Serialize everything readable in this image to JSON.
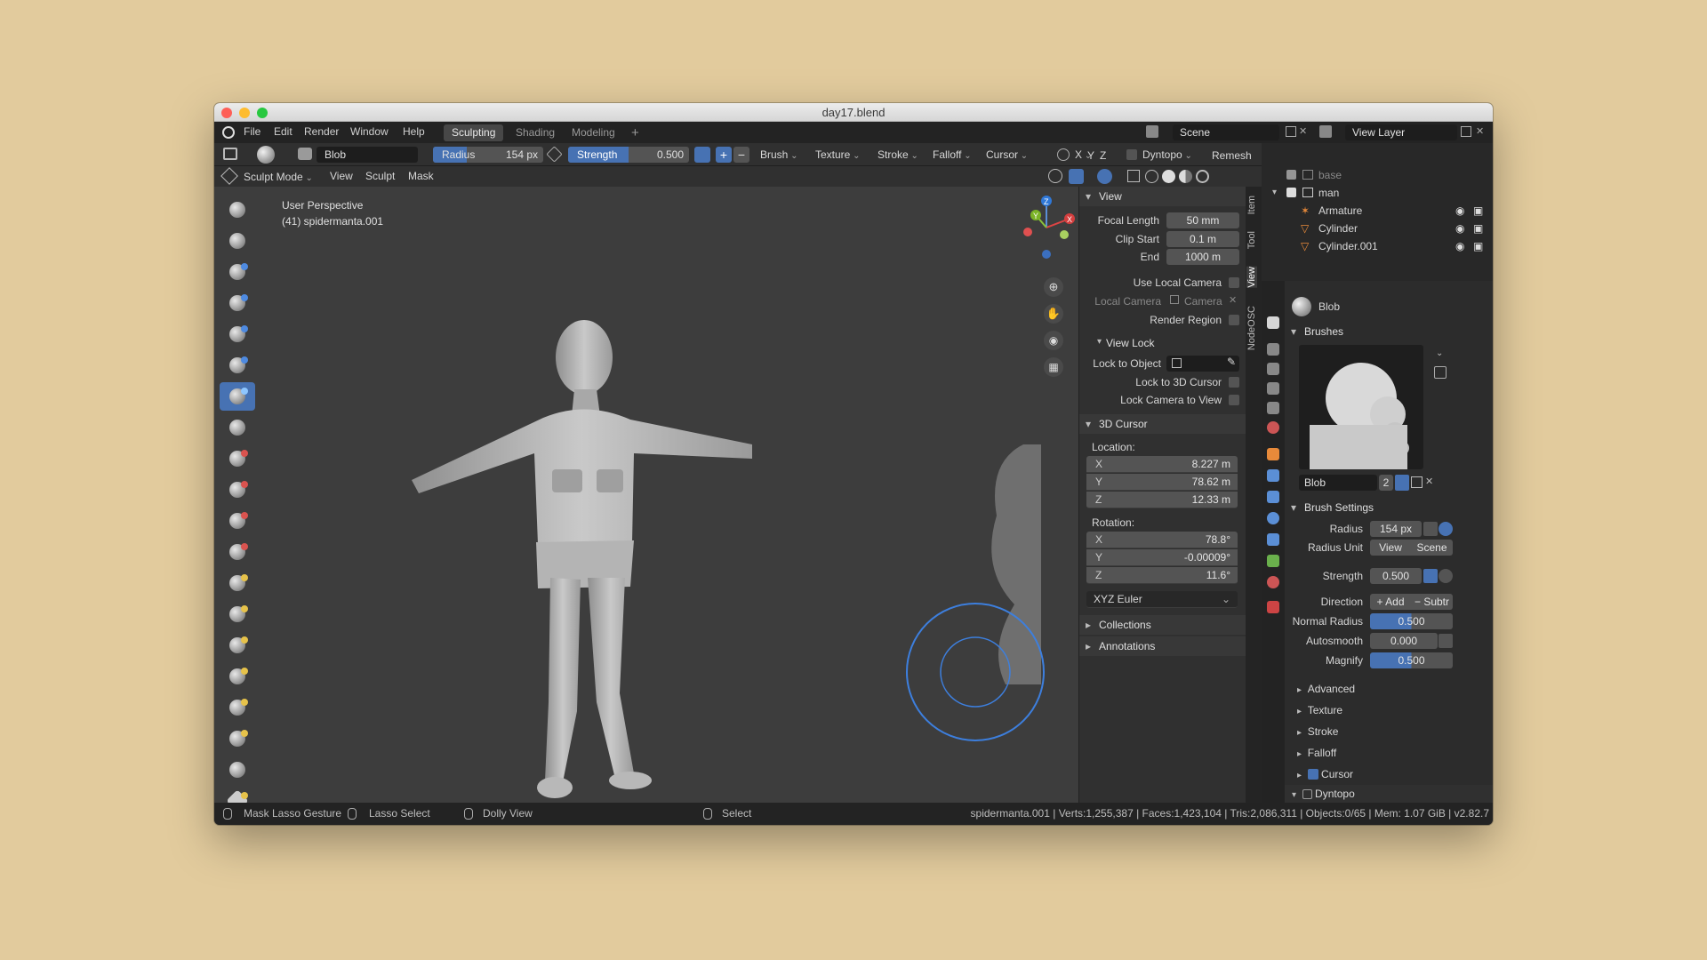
{
  "window": {
    "title": "day17.blend"
  },
  "topbar": {
    "menus": [
      "File",
      "Edit",
      "Render",
      "Window",
      "Help"
    ],
    "workspaces": [
      {
        "label": "Sculpting",
        "active": true
      },
      {
        "label": "Shading",
        "active": false
      },
      {
        "label": "Modeling",
        "active": false
      }
    ],
    "add_tab": "+",
    "scene": "Scene",
    "view_layer": "View Layer"
  },
  "tool_header": {
    "brush_name": "Blob",
    "radius_label": "Radius",
    "radius_value": "154 px",
    "strength_label": "Strength",
    "strength_value": "0.500",
    "dropdowns": [
      "Brush",
      "Texture",
      "Stroke",
      "Falloff",
      "Cursor"
    ],
    "axes": [
      "X",
      "Y",
      "Z"
    ],
    "dyntopo": "Dyntopo",
    "remesh": "Remesh"
  },
  "viewport_header": {
    "mode": "Sculpt Mode",
    "menus": [
      "View",
      "Sculpt",
      "Mask"
    ]
  },
  "viewport": {
    "perspective": "User Perspective",
    "object_info": "(41) spidermanta.001",
    "gizmo": {
      "x": "X",
      "y": "Y",
      "z": "Z"
    }
  },
  "npanel": {
    "tabs": [
      "Item",
      "Tool",
      "View",
      "NodeOSC"
    ],
    "view_section": "View",
    "focal_length_label": "Focal Length",
    "focal_length": "50 mm",
    "clip_start_label": "Clip Start",
    "clip_start": "0.1 m",
    "clip_end_label": "End",
    "clip_end": "1000 m",
    "use_local_camera": "Use Local Camera",
    "local_camera_label": "Local Camera",
    "local_camera_value": "Camera",
    "render_region": "Render Region",
    "view_lock_section": "View Lock",
    "lock_to_object": "Lock to Object",
    "lock_to_3d_cursor": "Lock to 3D Cursor",
    "lock_camera_to_view": "Lock Camera to View",
    "cursor_section": "3D Cursor",
    "location_label": "Location:",
    "location": [
      {
        "axis": "X",
        "value": "8.227 m"
      },
      {
        "axis": "Y",
        "value": "78.62 m"
      },
      {
        "axis": "Z",
        "value": "12.33 m"
      }
    ],
    "rotation_label": "Rotation:",
    "rotation": [
      {
        "axis": "X",
        "value": "78.8°"
      },
      {
        "axis": "Y",
        "value": "-0.00009°"
      },
      {
        "axis": "Z",
        "value": "11.6°"
      }
    ],
    "rotation_mode": "XYZ Euler",
    "collections": "Collections",
    "annotations": "Annotations"
  },
  "outliner": {
    "items": [
      {
        "name": "base",
        "indent": 1
      },
      {
        "name": "man",
        "indent": 1
      },
      {
        "name": "Armature",
        "indent": 2
      },
      {
        "name": "Cylinder",
        "indent": 2
      },
      {
        "name": "Cylinder.001",
        "indent": 2
      }
    ]
  },
  "properties": {
    "brush_name": "Blob",
    "brushes_section": "Brushes",
    "brush_field": "Blob",
    "brush_users": "2",
    "brush_settings_section": "Brush Settings",
    "radius_label": "Radius",
    "radius_value": "154 px",
    "radius_unit_label": "Radius Unit",
    "radius_unit_view": "View",
    "radius_unit_scene": "Scene",
    "strength_label": "Strength",
    "strength_value": "0.500",
    "direction_label": "Direction",
    "direction_add": "+ Add",
    "direction_sub": "− Subtr",
    "normal_radius_label": "Normal Radius",
    "normal_radius_value": "0.500",
    "autosmooth_label": "Autosmooth",
    "autosmooth_value": "0.000",
    "magnify_label": "Magnify",
    "magnify_value": "0.500",
    "subsections": [
      "Advanced",
      "Texture",
      "Stroke",
      "Falloff"
    ],
    "cursor_subsection": "Cursor",
    "dyntopo_section": "Dyntopo"
  },
  "status": {
    "mask_lasso": "Mask Lasso Gesture",
    "lasso_select": "Lasso Select",
    "dolly_view": "Dolly View",
    "select": "Select",
    "stats": "spidermanta.001 | Verts:1,255,387 | Faces:1,423,104 | Tris:2,086,311 | Objects:0/65 | Mem: 1.07 GiB | v2.82.7"
  },
  "colors": {
    "accent": "#4772b3",
    "background": "#e2cb9d",
    "viewport": "#3d3d3d"
  }
}
